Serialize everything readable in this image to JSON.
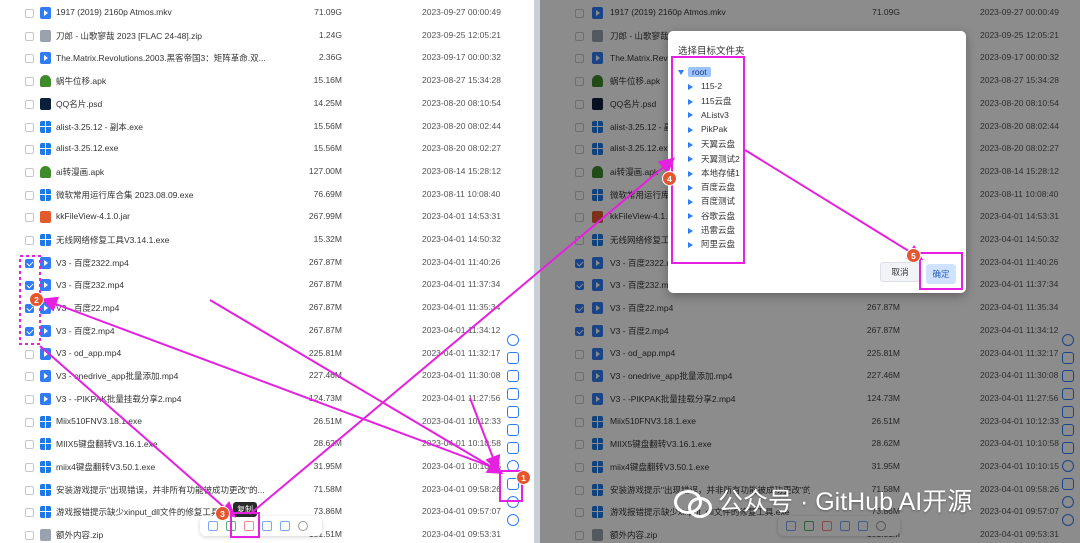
{
  "files": [
    {
      "name": "1917 (2019) 2160p Atmos.mkv",
      "size": "71.09G",
      "date": "2023-09-27 00:00:49",
      "icon": "video",
      "checked": false
    },
    {
      "name": "刀郎 - 山歌寥哉 2023 [FLAC 24-48].zip",
      "size": "1.24G",
      "date": "2023-09-25 12:05:21",
      "icon": "zip",
      "checked": false
    },
    {
      "name": "The.Matrix.Revolutions.2003.黑客帝国3：矩阵革命.双...",
      "size": "2.36G",
      "date": "2023-09-17 00:00:32",
      "icon": "video",
      "checked": false
    },
    {
      "name": "蜗牛位移.apk",
      "size": "15.16M",
      "date": "2023-08-27 15:34:28",
      "icon": "apk",
      "checked": false
    },
    {
      "name": "QQ名片.psd",
      "size": "14.25M",
      "date": "2023-08-20 08:10:54",
      "icon": "psd",
      "checked": false
    },
    {
      "name": "alist-3.25.12 - 副本.exe",
      "size": "15.56M",
      "date": "2023-08-20 08:02:44",
      "icon": "exe",
      "checked": false
    },
    {
      "name": "alist-3.25.12.exe",
      "size": "15.56M",
      "date": "2023-08-20 08:02:27",
      "icon": "exe",
      "checked": false
    },
    {
      "name": "ai转漫画.apk",
      "size": "127.00M",
      "date": "2023-08-14 15:28:12",
      "icon": "apk",
      "checked": false
    },
    {
      "name": "微软常用运行库合集 2023.08.09.exe",
      "size": "76.69M",
      "date": "2023-08-11 10:08:40",
      "icon": "exe",
      "checked": false
    },
    {
      "name": "kkFileView-4.1.0.jar",
      "size": "267.99M",
      "date": "2023-04-01 14:53:31",
      "icon": "jar",
      "checked": false
    },
    {
      "name": "无线网络修复工具V3.14.1.exe",
      "size": "15.32M",
      "date": "2023-04-01 14:50:32",
      "icon": "exe",
      "checked": false
    },
    {
      "name": "V3 - 百度2322.mp4",
      "size": "267.87M",
      "date": "2023-04-01 11:40:26",
      "icon": "video",
      "checked": true
    },
    {
      "name": "V3 - 百度232.mp4",
      "size": "267.87M",
      "date": "2023-04-01 11:37:34",
      "icon": "video",
      "checked": true
    },
    {
      "name": "V3 - 百度22.mp4",
      "size": "267.87M",
      "date": "2023-04-01 11:35:34",
      "icon": "video",
      "checked": true
    },
    {
      "name": "V3 - 百度2.mp4",
      "size": "267.87M",
      "date": "2023-04-01 11:34:12",
      "icon": "video",
      "checked": true
    },
    {
      "name": "V3 - od_app.mp4",
      "size": "225.81M",
      "date": "2023-04-01 11:32:17",
      "icon": "video",
      "checked": false
    },
    {
      "name": "V3 - onedrive_app批量添加.mp4",
      "size": "227.46M",
      "date": "2023-04-01 11:30:08",
      "icon": "video",
      "checked": false
    },
    {
      "name": "V3 - -PIKPAK批量挂载分享2.mp4",
      "size": "124.73M",
      "date": "2023-04-01 11:27:56",
      "icon": "video",
      "checked": false
    },
    {
      "name": "Miix510FNV3.18.1.exe",
      "size": "26.51M",
      "date": "2023-04-01 10:12:33",
      "icon": "exe",
      "checked": false
    },
    {
      "name": "MIIX5键盘翻转V3.16.1.exe",
      "size": "28.62M",
      "date": "2023-04-01 10:10:58",
      "icon": "exe",
      "checked": false
    },
    {
      "name": "miix4键盘翻转V3.50.1.exe",
      "size": "31.95M",
      "date": "2023-04-01 10:10:15",
      "icon": "exe",
      "checked": false
    },
    {
      "name": "安装游戏提示\"出现错误，并非所有功能被成功更改\"的...",
      "size": "71.58M",
      "date": "2023-04-01 09:58:26",
      "icon": "exe",
      "checked": false
    },
    {
      "name": "游戏报错提示缺少xinput_dll文件的修复工具.exe",
      "size": "73.86M",
      "date": "2023-04-01 09:57:07",
      "icon": "exe",
      "checked": false
    },
    {
      "name": "额外内容.zip",
      "size": "181.51M",
      "date": "2023-04-01 09:53:31",
      "icon": "zip",
      "checked": false
    }
  ],
  "tooltip": {
    "copy": "复制"
  },
  "dialog": {
    "title": "选择目标文件夹",
    "root": "root",
    "folders": [
      "115-2",
      "115云盘",
      "AListv3",
      "PikPak",
      "天翼云盘",
      "天翼测试2",
      "本地存储1",
      "百度云盘",
      "百度测试",
      "谷歌云盘",
      "迅雷云盘",
      "阿里云盘"
    ],
    "cancel_label": "取消",
    "ok_label": "确定"
  },
  "badges": [
    "1",
    "2",
    "3",
    "4",
    "5"
  ],
  "watermark": "公众号 · GitHub AI开源",
  "colors": {
    "accent": "#2f7cf6",
    "annotation": "#e520e0",
    "badge": "#e4572e"
  }
}
